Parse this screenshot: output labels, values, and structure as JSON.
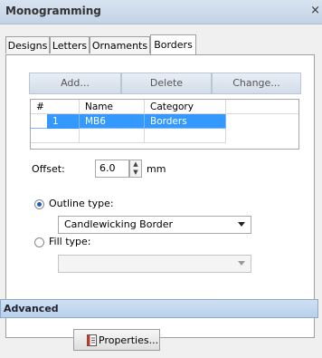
{
  "window": {
    "title": "Monogramming",
    "close_label": "×"
  },
  "tabs": [
    {
      "label": "Designs"
    },
    {
      "label": "Letters"
    },
    {
      "label": "Ornaments"
    },
    {
      "label": "Borders",
      "active": true
    }
  ],
  "toolbar": {
    "add_label": "Add...",
    "delete_label": "Delete",
    "change_label": "Change..."
  },
  "table": {
    "columns": [
      "#",
      "Name",
      "Category"
    ],
    "rows": [
      {
        "num": "1",
        "name": "MB6",
        "category": "Borders",
        "selected": true
      }
    ]
  },
  "offset": {
    "label": "Offset:",
    "value": "6.0",
    "unit": "mm"
  },
  "outline": {
    "label": "Outline type:",
    "selected": true,
    "value": "Candlewicking Border"
  },
  "fill": {
    "label": "Fill type:",
    "selected": false,
    "value": ""
  },
  "advanced": {
    "label": "Advanced"
  },
  "properties": {
    "label": "Properties..."
  },
  "colors": {
    "selection": "#3399ff",
    "header_bar": "#c3d3e6"
  }
}
